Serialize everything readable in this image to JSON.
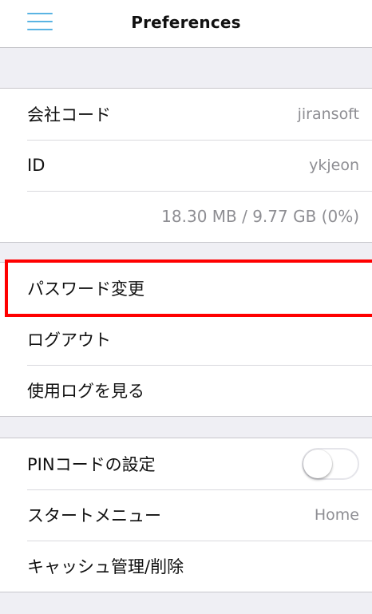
{
  "header": {
    "title": "Preferences",
    "menu_icon": "hamburger-menu-icon"
  },
  "account": {
    "company_code_label": "会社コード",
    "company_code_value": "jiransoft",
    "id_label": "ID",
    "id_value": "ykjeon",
    "storage": "18.30 MB / 9.77 GB (0%)"
  },
  "actions": {
    "change_password": "パスワード変更",
    "logout": "ログアウト",
    "view_usage_log": "使用ログを見る"
  },
  "settings": {
    "pin_code_label": "PINコードの設定",
    "pin_code_enabled": false,
    "start_menu_label": "スタートメニュー",
    "start_menu_value": "Home",
    "cache_label": "キャッシュ管理/削除"
  },
  "highlight_color": "#ff0000",
  "accent_color": "#5ab4e3"
}
